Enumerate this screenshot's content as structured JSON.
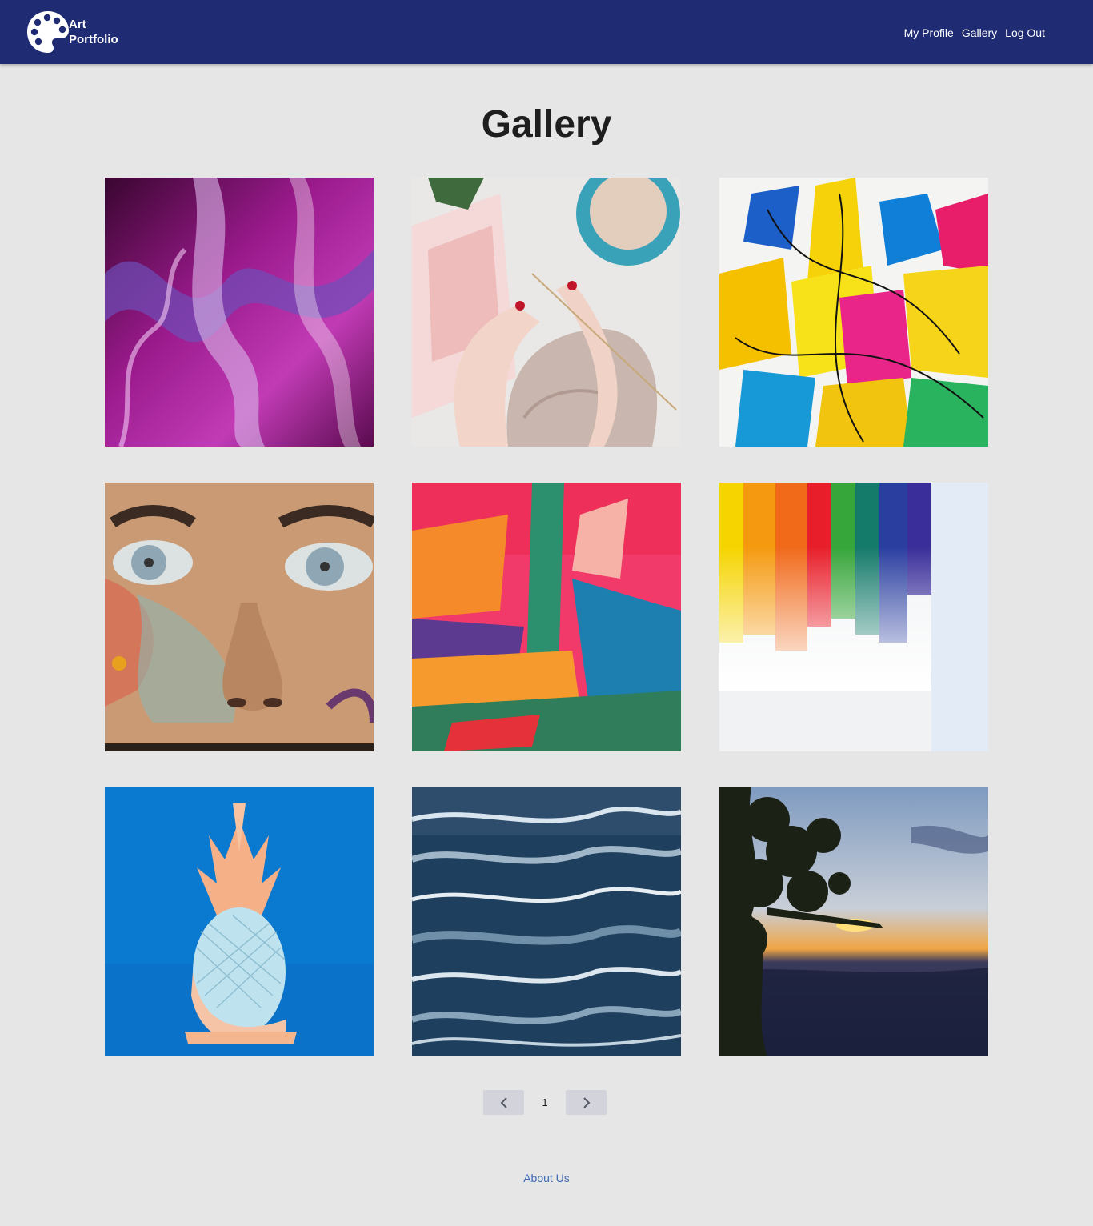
{
  "navbar": {
    "brand_line1": "Art",
    "brand_line2": "Portfolio",
    "links": [
      "My Profile",
      "Gallery",
      "Log Out"
    ],
    "background": "#1f2c73"
  },
  "page": {
    "title": "Gallery",
    "background": "#e6e6e6"
  },
  "gallery": {
    "images": [
      {
        "subject": "purple fluid marble paint"
      },
      {
        "subject": "hands knitting with coffee cup and magazine"
      },
      {
        "subject": "colorful abstract paint splashes"
      },
      {
        "subject": "painted face mural with blue eyes"
      },
      {
        "subject": "abstract orange pink and teal brush strokes"
      },
      {
        "subject": "rainbow paint drips on white canvas"
      },
      {
        "subject": "pastel pineapple on blue background"
      },
      {
        "subject": "dark blue ocean wave painting"
      },
      {
        "subject": "sunset over canyon with tree silhouette"
      }
    ]
  },
  "pagination": {
    "current_page": "1",
    "prev_icon": "chevron-left-icon",
    "next_icon": "chevron-right-icon"
  },
  "footer": {
    "about_label": "About Us",
    "link_color": "#3f6cb3"
  }
}
